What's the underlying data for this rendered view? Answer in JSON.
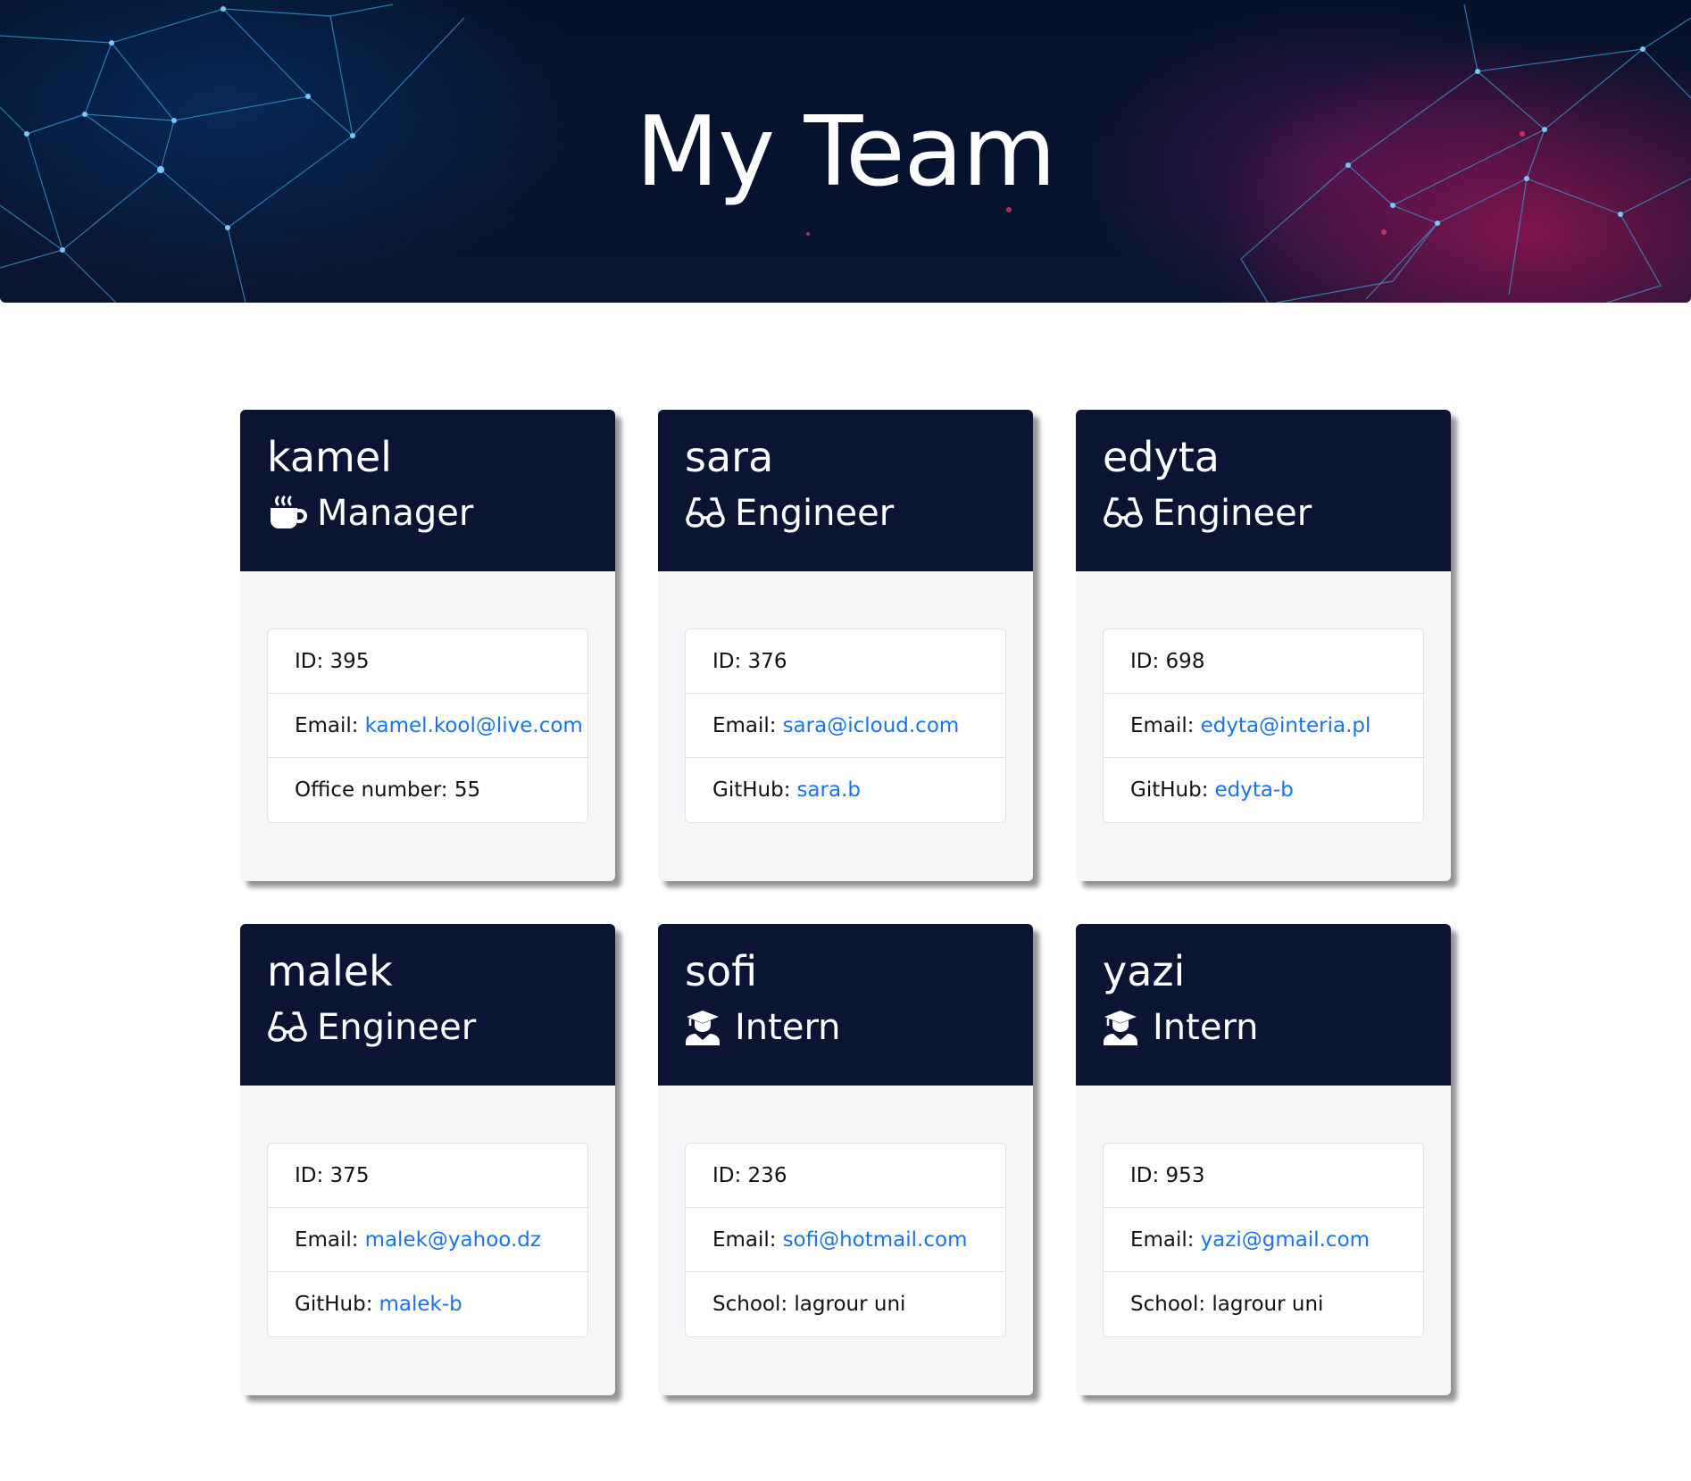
{
  "header": {
    "title": "My Team"
  },
  "employees": [
    {
      "name": "kamel",
      "role": "Manager",
      "icon": "coffee-mug-icon",
      "id_label": "ID: 395",
      "email_label": "Email:",
      "email": "kamel.kool@live.com",
      "extra_label": "Office number: 55",
      "extra_link": ""
    },
    {
      "name": "sara",
      "role": "Engineer",
      "icon": "glasses-icon",
      "id_label": "ID: 376",
      "email_label": "Email:",
      "email": "sara@icloud.com",
      "extra_label": "GitHub:",
      "extra_link": "sara.b"
    },
    {
      "name": "edyta",
      "role": "Engineer",
      "icon": "glasses-icon",
      "id_label": "ID: 698",
      "email_label": "Email:",
      "email": "edyta@interia.pl",
      "extra_label": "GitHub:",
      "extra_link": "edyta-b"
    },
    {
      "name": "malek",
      "role": "Engineer",
      "icon": "glasses-icon",
      "id_label": "ID: 375",
      "email_label": "Email:",
      "email": "malek@yahoo.dz",
      "extra_label": "GitHub:",
      "extra_link": "malek-b"
    },
    {
      "name": "sofi",
      "role": "Intern",
      "icon": "graduate-icon",
      "id_label": "ID: 236",
      "email_label": "Email:",
      "email": "sofi@hotmail.com",
      "extra_label": "School: lagrour uni",
      "extra_link": ""
    },
    {
      "name": "yazi",
      "role": "Intern",
      "icon": "graduate-icon",
      "id_label": "ID: 953",
      "email_label": "Email:",
      "email": "yazi@gmail.com",
      "extra_label": "School: lagrour uni",
      "extra_link": ""
    }
  ],
  "colors": {
    "card_header": "#0b1433",
    "card_body": "#f5f6f8",
    "link": "#1a73e8",
    "hero_background": "#03112a",
    "hero_accent": "#c4145c"
  }
}
